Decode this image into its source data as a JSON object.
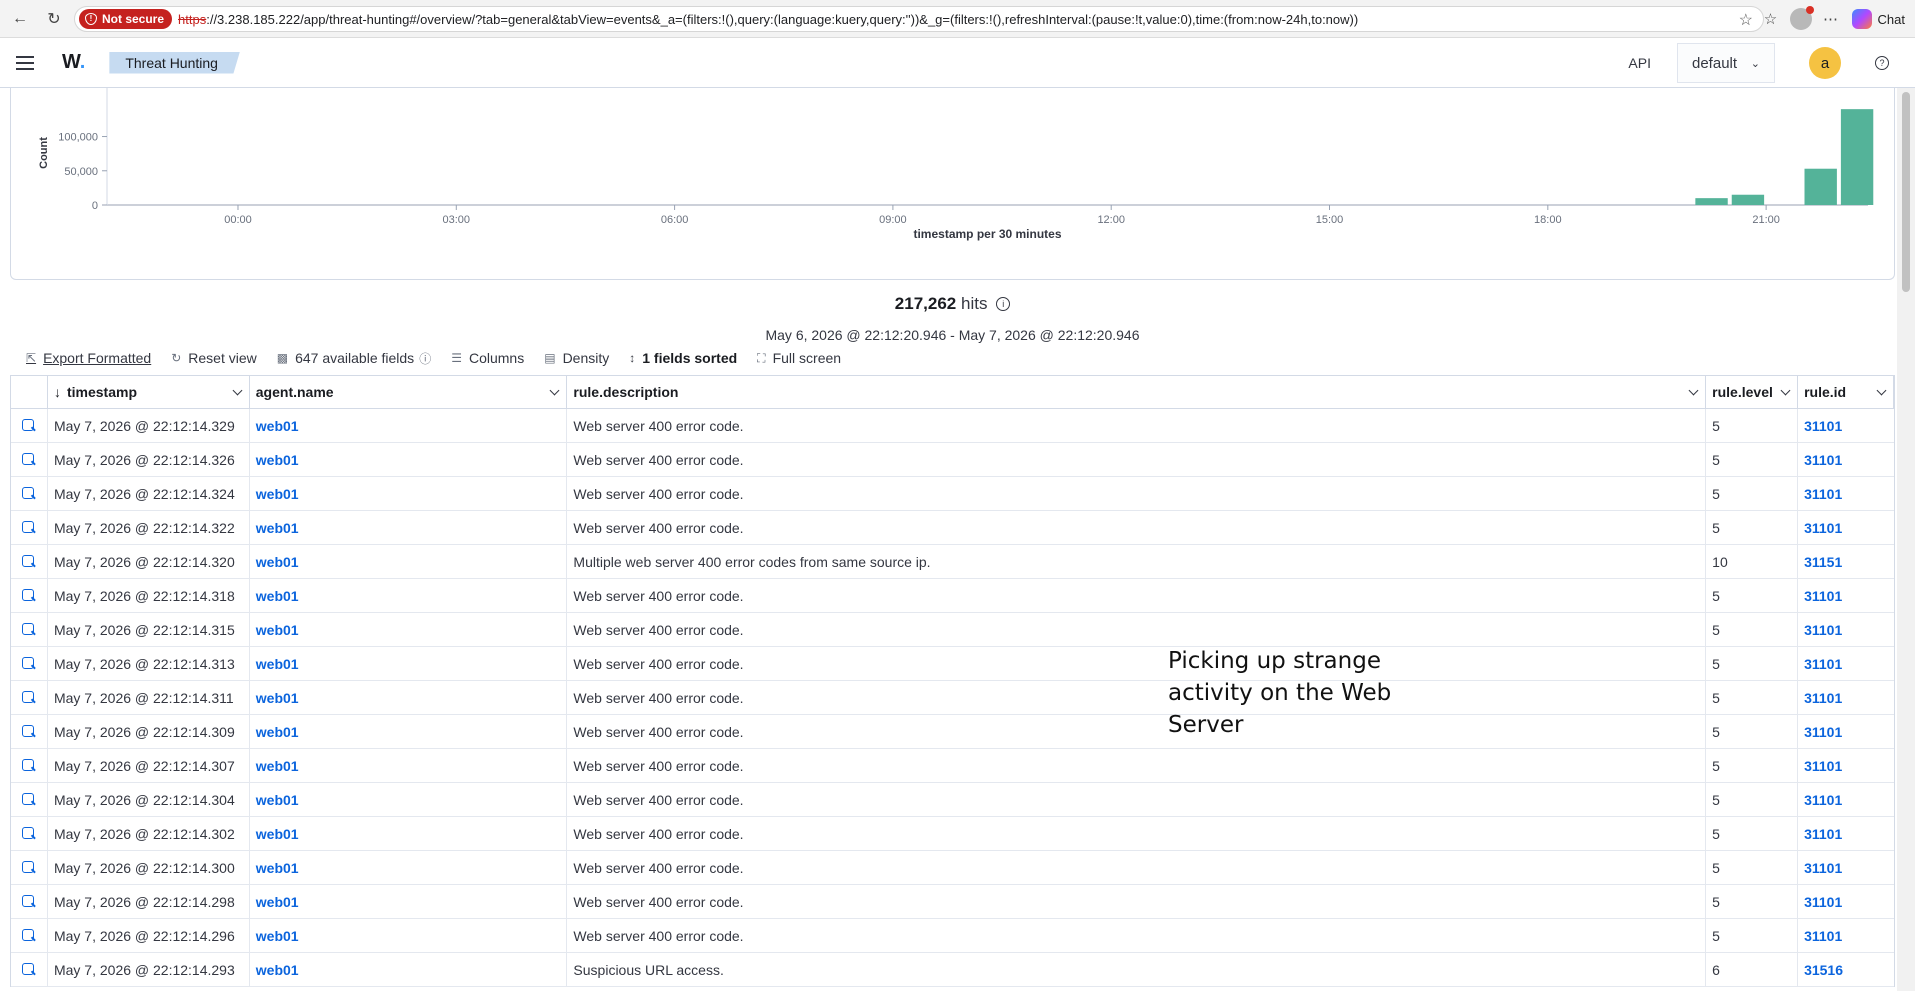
{
  "browser": {
    "security_label": "Not secure",
    "url_protocol": "https",
    "url_rest": "://3.238.185.222/app/threat-hunting#/overview/?tab=general&tabView=events&_a=(filters:!(),query:(language:kuery,query:''))&_g=(filters:!(),refreshInterval:(pause:!t,value:0),time:(from:now-24h,to:now))",
    "chat_label": "Chat"
  },
  "app": {
    "logo_text": "W",
    "breadcrumb": "Threat Hunting",
    "api_label": "API",
    "tenant": "default",
    "avatar_initial": "a"
  },
  "chart_data": {
    "type": "bar",
    "xlabel": "timestamp per 30 minutes",
    "ylabel": "Count",
    "y_ticks": [
      "0",
      "50,000",
      "100,000"
    ],
    "x_ticks": [
      "00:00",
      "03:00",
      "06:00",
      "09:00",
      "12:00",
      "15:00",
      "18:00",
      "21:00"
    ],
    "x_hours": [
      20.0,
      20.5,
      21.5,
      22.0
    ],
    "values": [
      10000,
      15000,
      53000,
      140000
    ],
    "ylim": [
      0,
      130000
    ],
    "x_range_hours": [
      -1.8,
      22.4
    ],
    "bar_color": "#54b399",
    "grid": false
  },
  "summary": {
    "hits_count": "217,262",
    "hits_label": "hits",
    "range": "May 6, 2026 @ 22:12:20.946 - May 7, 2026 @ 22:12:20.946"
  },
  "toolbar": {
    "export": "Export Formatted",
    "reset": "Reset view",
    "fields": "647 available fields",
    "columns": "Columns",
    "density": "Density",
    "sorted": "1 fields sorted",
    "fullscreen": "Full screen"
  },
  "table": {
    "headers": [
      "timestamp",
      "agent.name",
      "rule.description",
      "rule.level",
      "rule.id"
    ],
    "rows": [
      {
        "timestamp": "May 7, 2026 @ 22:12:14.329",
        "agent": "web01",
        "description": "Web server 400 error code.",
        "level": "5",
        "id": "31101"
      },
      {
        "timestamp": "May 7, 2026 @ 22:12:14.326",
        "agent": "web01",
        "description": "Web server 400 error code.",
        "level": "5",
        "id": "31101"
      },
      {
        "timestamp": "May 7, 2026 @ 22:12:14.324",
        "agent": "web01",
        "description": "Web server 400 error code.",
        "level": "5",
        "id": "31101"
      },
      {
        "timestamp": "May 7, 2026 @ 22:12:14.322",
        "agent": "web01",
        "description": "Web server 400 error code.",
        "level": "5",
        "id": "31101"
      },
      {
        "timestamp": "May 7, 2026 @ 22:12:14.320",
        "agent": "web01",
        "description": "Multiple web server 400 error codes from same source ip.",
        "level": "10",
        "id": "31151"
      },
      {
        "timestamp": "May 7, 2026 @ 22:12:14.318",
        "agent": "web01",
        "description": "Web server 400 error code.",
        "level": "5",
        "id": "31101"
      },
      {
        "timestamp": "May 7, 2026 @ 22:12:14.315",
        "agent": "web01",
        "description": "Web server 400 error code.",
        "level": "5",
        "id": "31101"
      },
      {
        "timestamp": "May 7, 2026 @ 22:12:14.313",
        "agent": "web01",
        "description": "Web server 400 error code.",
        "level": "5",
        "id": "31101"
      },
      {
        "timestamp": "May 7, 2026 @ 22:12:14.311",
        "agent": "web01",
        "description": "Web server 400 error code.",
        "level": "5",
        "id": "31101"
      },
      {
        "timestamp": "May 7, 2026 @ 22:12:14.309",
        "agent": "web01",
        "description": "Web server 400 error code.",
        "level": "5",
        "id": "31101"
      },
      {
        "timestamp": "May 7, 2026 @ 22:12:14.307",
        "agent": "web01",
        "description": "Web server 400 error code.",
        "level": "5",
        "id": "31101"
      },
      {
        "timestamp": "May 7, 2026 @ 22:12:14.304",
        "agent": "web01",
        "description": "Web server 400 error code.",
        "level": "5",
        "id": "31101"
      },
      {
        "timestamp": "May 7, 2026 @ 22:12:14.302",
        "agent": "web01",
        "description": "Web server 400 error code.",
        "level": "5",
        "id": "31101"
      },
      {
        "timestamp": "May 7, 2026 @ 22:12:14.300",
        "agent": "web01",
        "description": "Web server 400 error code.",
        "level": "5",
        "id": "31101"
      },
      {
        "timestamp": "May 7, 2026 @ 22:12:14.298",
        "agent": "web01",
        "description": "Web server 400 error code.",
        "level": "5",
        "id": "31101"
      },
      {
        "timestamp": "May 7, 2026 @ 22:12:14.296",
        "agent": "web01",
        "description": "Web server 400 error code.",
        "level": "5",
        "id": "31101"
      },
      {
        "timestamp": "May 7, 2026 @ 22:12:14.293",
        "agent": "web01",
        "description": "Suspicious URL access.",
        "level": "6",
        "id": "31516"
      }
    ]
  },
  "annotation": {
    "lines": [
      "Picking up strange",
      "activity on the Web",
      "Server"
    ]
  },
  "colors": {
    "link": "#0b64dd",
    "bar": "#54b399",
    "not_secure": "#c5221f",
    "breadcrumb_bg": "#c6dbf1",
    "avatar_bg": "#f5c242"
  }
}
